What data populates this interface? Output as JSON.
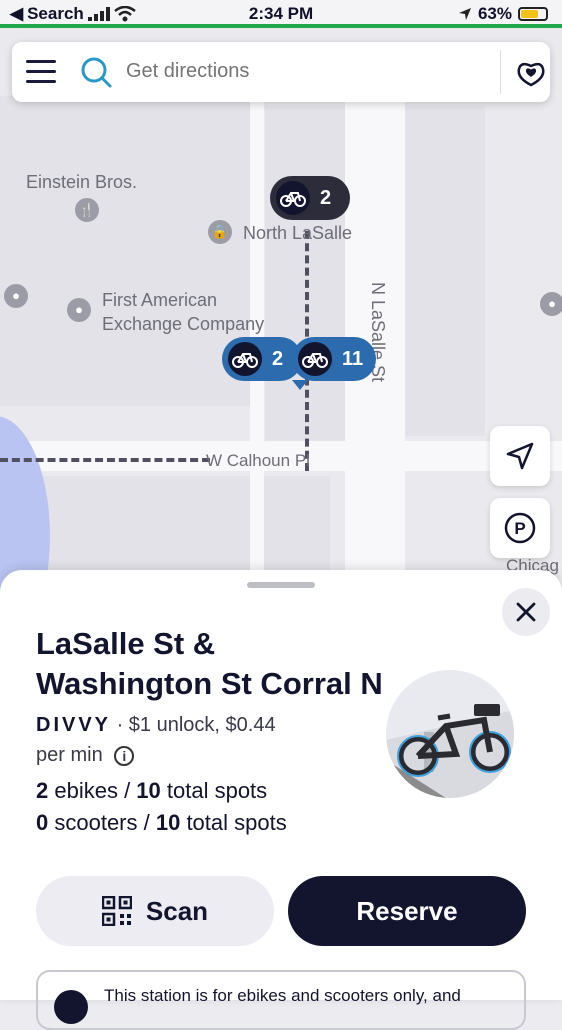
{
  "status_bar": {
    "back_label": "Search",
    "time": "2:34 PM",
    "battery": "63%"
  },
  "search": {
    "placeholder": "Get directions"
  },
  "map": {
    "labels": {
      "einstein": "Einstein Bros.",
      "north_lasalle": "North LaSalle",
      "first_american_1": "First American",
      "first_american_2": "Exchange Company",
      "lasalle_st": "N LaSalle St",
      "calhoun": "W Calhoun Pl",
      "chicago": "Chicag"
    },
    "markers": [
      {
        "count": "2"
      },
      {
        "count": "2"
      },
      {
        "count": "11"
      }
    ]
  },
  "station": {
    "title_line1": "LaSalle St &",
    "title_line2": "Washington St Corral N",
    "provider": "DIVVY",
    "pricing_1": "· $1 unlock, $0.44",
    "pricing_2": "per min",
    "ebikes_count": "2",
    "ebikes_text": " ebikes / ",
    "ebike_spots": "10",
    "spots_text": " total spots",
    "scooters_count": "0",
    "scooters_text": " scooters / ",
    "scooter_spots": "10"
  },
  "actions": {
    "scan": "Scan",
    "reserve": "Reserve"
  },
  "notice": {
    "text": "This station is for ebikes and scooters only, and"
  },
  "colors": {
    "accent_dark": "#13142e",
    "marker_blue": "#2c6bad",
    "status_green": "#1fa74a"
  }
}
